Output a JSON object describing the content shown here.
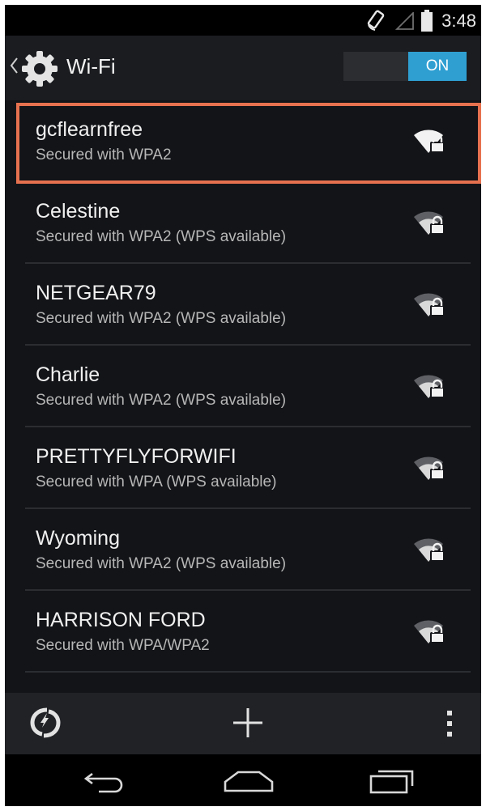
{
  "status_bar": {
    "time": "3:48"
  },
  "action_bar": {
    "title": "Wi-Fi",
    "toggle_label": "ON"
  },
  "networks": [
    {
      "name": "gcflearnfree",
      "security": "Secured with WPA2",
      "selected": true
    },
    {
      "name": "Celestine",
      "security": "Secured with WPA2 (WPS available)"
    },
    {
      "name": "NETGEAR79",
      "security": "Secured with WPA2 (WPS available)"
    },
    {
      "name": "Charlie",
      "security": "Secured with WPA2 (WPS available)"
    },
    {
      "name": "PRETTYFLYFORWIFI",
      "security": "Secured with WPA (WPS available)"
    },
    {
      "name": "Wyoming",
      "security": "Secured with WPA2 (WPS available)"
    },
    {
      "name": "HARRISON FORD",
      "security": "Secured with WPA/WPA2"
    }
  ],
  "icons": {
    "status": [
      "rotation-lock-icon",
      "cell-signal-icon",
      "battery-icon"
    ],
    "action_bar": [
      "back-chevron-icon",
      "gear-icon"
    ],
    "network": "wifi-locked-icon",
    "toolbar": [
      "wps-icon",
      "add-network-icon",
      "overflow-menu-icon"
    ],
    "nav": [
      "nav-back-icon",
      "nav-home-icon",
      "nav-recent-apps-icon"
    ]
  },
  "colors": {
    "toggle_on": "#2f9fd2",
    "highlight_border": "#e6714f",
    "background": "#131418"
  }
}
